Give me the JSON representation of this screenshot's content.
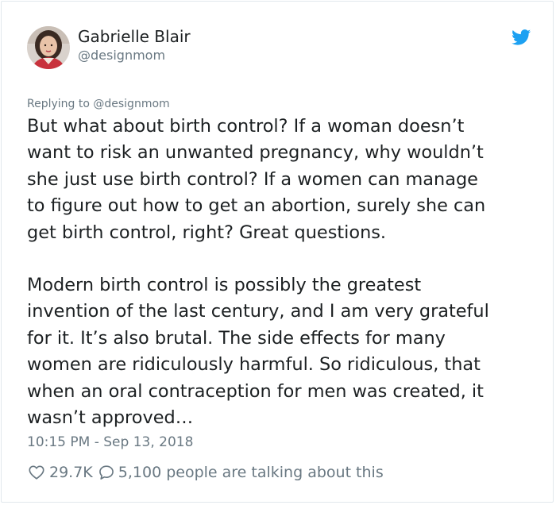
{
  "author": {
    "display_name": "Gabrielle Blair",
    "handle": "@designmom",
    "avatar_icon": "avatar-photo",
    "brand_icon": "twitter-bird-icon",
    "brand_color": "#1da1f2"
  },
  "tweet": {
    "replying_to": "Replying to @designmom",
    "paragraph_1_lines": [
      "But what about birth control? If a woman doesn’t",
      "want to risk an unwanted pregnancy, why wouldn’t",
      "she just use birth control? If a women can manage",
      "to figure out how to get an abortion, surely she can",
      "get birth control, right? Great questions."
    ],
    "paragraph_2_lines": [
      "Modern birth control is possibly the greatest",
      "invention of the last century, and I am very grateful",
      "for it. It’s also brutal. The side effects for many",
      "women are ridiculously harmful. So ridiculous, that",
      "when an oral contraception for men was created, it",
      "wasn’t approved…"
    ],
    "timestamp": "10:15 PM - Sep 13, 2018"
  },
  "actions": {
    "like_icon": "heart-icon",
    "like_count": "29.7K",
    "reply_icon": "speech-bubble-icon",
    "conversation_text": "5,100 people are talking about this"
  },
  "colors": {
    "text": "#1c2022",
    "muted": "#697882",
    "border": "#e1e8ed"
  }
}
